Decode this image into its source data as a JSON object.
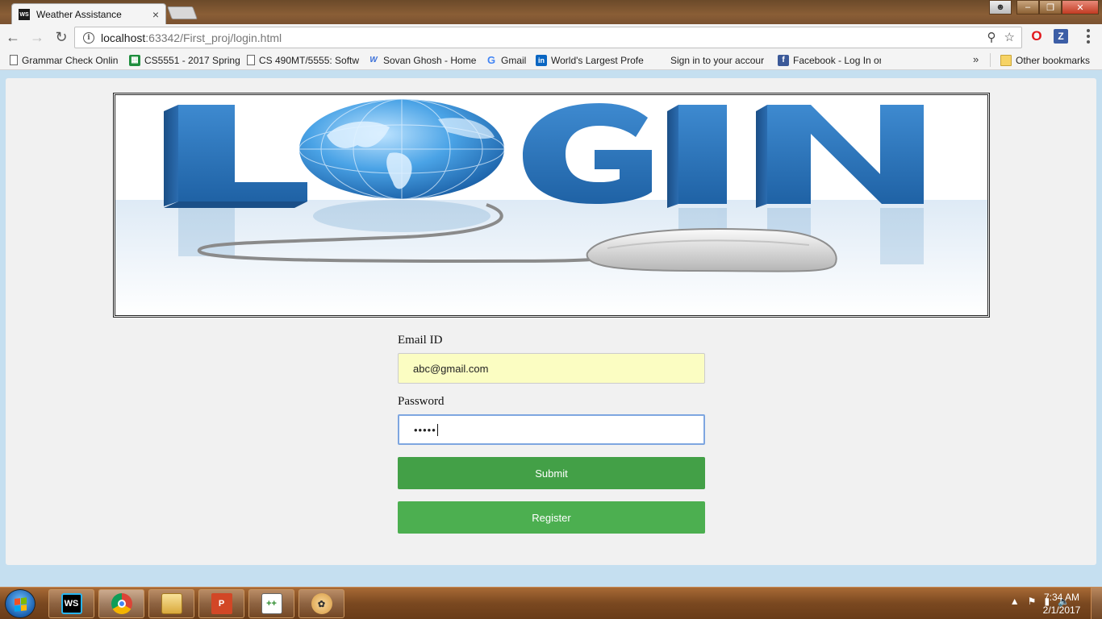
{
  "browser": {
    "tab": {
      "favicon": "WS",
      "title": "Weather Assistance",
      "close": "×"
    },
    "url": {
      "host": "localhost",
      "rest": ":63342/First_proj/login.html"
    },
    "bookmarks": [
      {
        "label": "Grammar Check Onlin",
        "icon": "page-icon"
      },
      {
        "label": "CS5551 - 2017 Spring",
        "icon": "sheets-icon"
      },
      {
        "label": "CS 490MT/5555: Softw",
        "icon": "page-icon"
      },
      {
        "label": "Sovan Ghosh - Home",
        "icon": "weebly-icon"
      },
      {
        "label": "Gmail",
        "icon": "google-icon"
      },
      {
        "label": "World's Largest Profe",
        "icon": "linkedin-icon"
      },
      {
        "label": "Sign in to your accour",
        "icon": "microsoft-icon"
      },
      {
        "label": "Facebook - Log In or S",
        "icon": "facebook-icon"
      }
    ],
    "bookmarks_more": "»",
    "other_bookmarks": "Other bookmarks"
  },
  "page": {
    "banner_alt": "LOGIN",
    "form": {
      "email_label": "Email ID",
      "email_value": "abc@gmail.com",
      "password_label": "Password",
      "password_value": "•••••",
      "submit_label": "Submit",
      "register_label": "Register"
    }
  },
  "taskbar": {
    "apps": [
      "webstorm-icon",
      "chrome-icon",
      "explorer-icon",
      "powerpoint-icon",
      "notepad-plus-icon",
      "paint-icon"
    ],
    "time": "7:34 AM",
    "date": "2/1/2017"
  },
  "colors": {
    "submit": "#43a047",
    "register": "#4caf50",
    "email_autofill": "#fbfdc2",
    "login_blue": "#2b78b8"
  }
}
